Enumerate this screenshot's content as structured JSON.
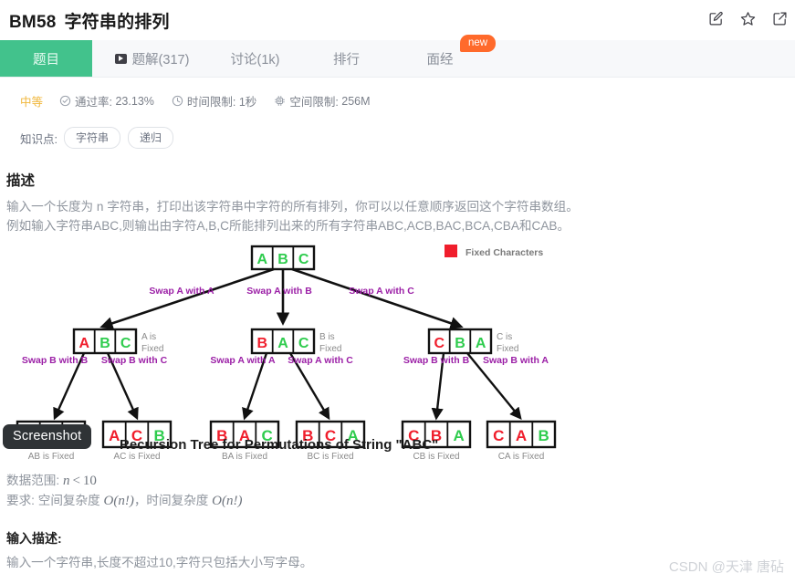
{
  "header": {
    "problem_code": "BM58",
    "problem_title": "字符串的排列",
    "actions": [
      {
        "name": "edit-icon",
        "label": "编辑"
      },
      {
        "name": "star-icon",
        "label": "收藏"
      },
      {
        "name": "share-external-icon",
        "label": "分享"
      }
    ]
  },
  "tabs": [
    {
      "label": "题目",
      "active": true,
      "icon": null
    },
    {
      "label": "题解(317)",
      "active": false,
      "icon": "play-icon"
    },
    {
      "label": "讨论(1k)",
      "active": false,
      "icon": null
    },
    {
      "label": "排行",
      "active": false,
      "icon": null
    },
    {
      "label": "面经",
      "active": false,
      "icon": null
    }
  ],
  "new_badge": "new",
  "meta": {
    "difficulty": "中等",
    "pass_rate_label": "通过率:",
    "pass_rate_value": "23.13%",
    "time_limit_label": "时间限制:",
    "time_limit_value": "1秒",
    "space_limit_label": "空间限制:",
    "space_limit_value": "256M"
  },
  "knowledge": {
    "label": "知识点:",
    "tags": [
      "字符串",
      "递归"
    ]
  },
  "description": {
    "heading": "描述",
    "line1": "输入一个长度为 n 字符串，打印出该字符串中字符的所有排列，你可以以任意顺序返回这个字符串数组。",
    "line2": "例如输入字符串ABC,则输出由字符A,B,C所能排列出来的所有字符串ABC,ACB,BAC,BCA,CBA和CAB。"
  },
  "constraints": {
    "range_label": "数据范围:",
    "range_var": "n",
    "range_op": "<",
    "range_value": "10",
    "require_label": "要求:",
    "space_label": "空间复杂度",
    "space_value": "O(n!)",
    "time_label": "，时间复杂度",
    "time_value": "O(n!)"
  },
  "input_section": {
    "heading": "输入描述:",
    "text": "输入一个字符串,长度不超过10,字符只包括大小写字母。"
  },
  "diagram": {
    "caption": "Recursion Tree for Permutations of String \"ABC\"",
    "legend_label": "Fixed Characters",
    "legend_color": "#f01e2c",
    "fixed_color": "#f01e2c",
    "free_color": "#2fcc4e",
    "edge_label_color": "#9b1fa6",
    "note_color": "#8b8b8b",
    "root": {
      "cells": [
        "A",
        "B",
        "C"
      ],
      "fixed": 0,
      "note": ""
    },
    "level1": [
      {
        "cells": [
          "A",
          "B",
          "C"
        ],
        "fixed": 1,
        "note_line1": "A is",
        "note_line2": "Fixed",
        "edge_label": "Swap A with A"
      },
      {
        "cells": [
          "B",
          "A",
          "C"
        ],
        "fixed": 1,
        "note_line1": "B is",
        "note_line2": "Fixed",
        "edge_label": "Swap A with B"
      },
      {
        "cells": [
          "C",
          "B",
          "A"
        ],
        "fixed": 1,
        "note_line1": "C is",
        "note_line2": "Fixed",
        "edge_label": "Swap A with C"
      }
    ],
    "level2": [
      {
        "cells": [
          "A",
          "B",
          "C"
        ],
        "fixed": 2,
        "note": "AB is Fixed",
        "edge_label": "Swap B with B"
      },
      {
        "cells": [
          "A",
          "C",
          "B"
        ],
        "fixed": 2,
        "note": "AC is Fixed",
        "edge_label": "Swap B with C"
      },
      {
        "cells": [
          "B",
          "A",
          "C"
        ],
        "fixed": 2,
        "note": "BA is Fixed",
        "edge_label": "Swap A with A"
      },
      {
        "cells": [
          "B",
          "C",
          "A"
        ],
        "fixed": 2,
        "note": "BC is Fixed",
        "edge_label": "Swap A with C"
      },
      {
        "cells": [
          "C",
          "B",
          "A"
        ],
        "fixed": 2,
        "note": "CB is Fixed",
        "edge_label": "Swap B with B"
      },
      {
        "cells": [
          "C",
          "A",
          "B"
        ],
        "fixed": 2,
        "note": "CA is Fixed",
        "edge_label": "Swap B with A"
      }
    ]
  },
  "screenshot_tooltip": "Screenshot",
  "watermark": "CSDN @天津 唐砧"
}
